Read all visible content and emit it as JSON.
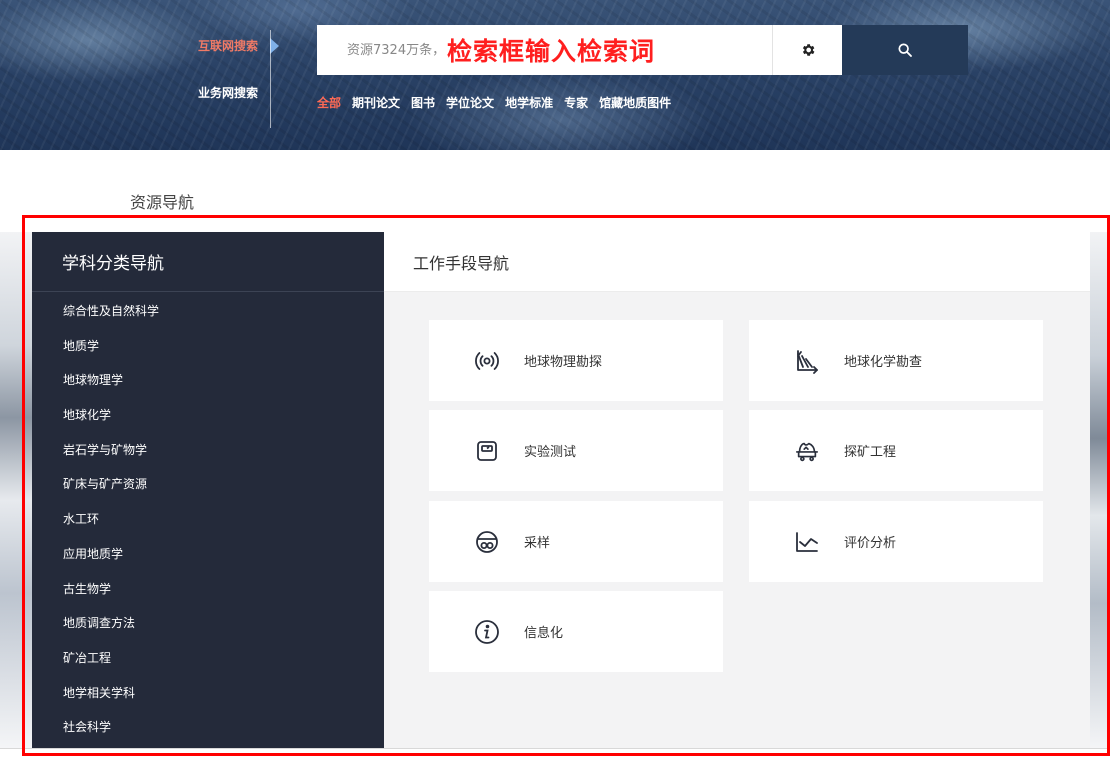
{
  "header": {
    "scopes": [
      {
        "label": "互联网搜索",
        "active": true
      },
      {
        "label": "业务网搜索",
        "active": false
      }
    ],
    "search": {
      "placeholder": "资源7324万条，",
      "overlay_text": "检索框输入检索词"
    },
    "resource_types": [
      {
        "label": "全部",
        "active": true
      },
      {
        "label": "期刊论文"
      },
      {
        "label": "图书"
      },
      {
        "label": "学位论文"
      },
      {
        "label": "地学标准"
      },
      {
        "label": "专家"
      },
      {
        "label": "馆藏地质图件"
      }
    ]
  },
  "resource_nav": {
    "title": "资源导航"
  },
  "subject_nav": {
    "title": "学科分类导航",
    "items": [
      "综合性及自然科学",
      "地质学",
      "地球物理学",
      "地球化学",
      "岩石学与矿物学",
      "矿床与矿产资源",
      "水工环",
      "应用地质学",
      "古生物学",
      "地质调查方法",
      "矿冶工程",
      "地学相关学科",
      "社会科学"
    ]
  },
  "work_nav": {
    "title": "工作手段导航",
    "cards": [
      {
        "label": "地球物理勘探",
        "icon": "broadcast-icon"
      },
      {
        "label": "地球化学勘查",
        "icon": "geochem-chart-icon"
      },
      {
        "label": "实验测试",
        "icon": "scale-icon"
      },
      {
        "label": "探矿工程",
        "icon": "mine-cart-icon"
      },
      {
        "label": "采样",
        "icon": "sample-icon"
      },
      {
        "label": "评价分析",
        "icon": "line-chart-icon"
      },
      {
        "label": "信息化",
        "icon": "info-icon"
      }
    ]
  },
  "colors": {
    "accent_red": "#ff1f1f",
    "active_orange": "#ff6a55",
    "sidebar_bg": "#242a3a",
    "search_button_bg": "#243a58"
  }
}
